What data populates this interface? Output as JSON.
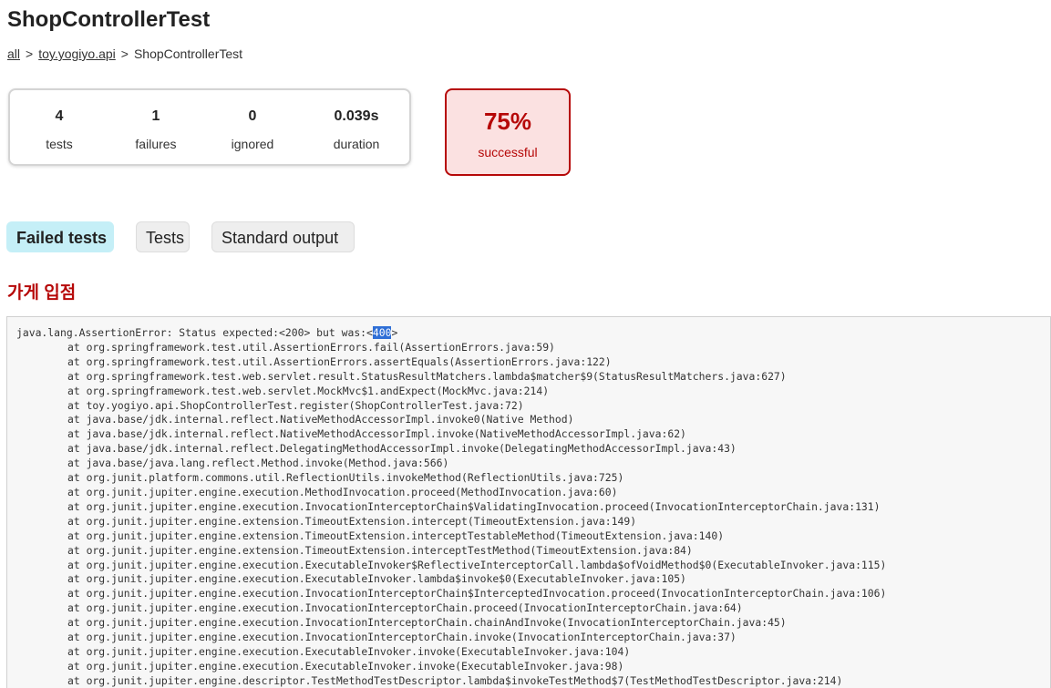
{
  "header": {
    "title": "ShopControllerTest"
  },
  "breadcrumb": {
    "items": [
      {
        "label": "all",
        "link": true
      },
      {
        "label": "toy.yogiyo.api",
        "link": true
      },
      {
        "label": "ShopControllerTest",
        "link": false
      }
    ],
    "separator": ">"
  },
  "summary": {
    "tests": {
      "value": "4",
      "label": "tests"
    },
    "failures": {
      "value": "1",
      "label": "failures"
    },
    "ignored": {
      "value": "0",
      "label": "ignored"
    },
    "duration": {
      "value": "0.039s",
      "label": "duration"
    },
    "success_rate": {
      "value": "75%",
      "label": "successful"
    }
  },
  "tabs": [
    {
      "label": "Failed tests",
      "selected": true
    },
    {
      "label": "Tests",
      "selected": false
    },
    {
      "label": "Standard output",
      "selected": false
    }
  ],
  "failed_test": {
    "name": "가게 입점",
    "first_line_prefix": "java.lang.AssertionError: Status expected:<200> but was:<",
    "first_line_highlight": "400",
    "first_line_suffix": ">",
    "frames": [
      "at org.springframework.test.util.AssertionErrors.fail(AssertionErrors.java:59)",
      "at org.springframework.test.util.AssertionErrors.assertEquals(AssertionErrors.java:122)",
      "at org.springframework.test.web.servlet.result.StatusResultMatchers.lambda$matcher$9(StatusResultMatchers.java:627)",
      "at org.springframework.test.web.servlet.MockMvc$1.andExpect(MockMvc.java:214)",
      "at toy.yogiyo.api.ShopControllerTest.register(ShopControllerTest.java:72)",
      "at java.base/jdk.internal.reflect.NativeMethodAccessorImpl.invoke0(Native Method)",
      "at java.base/jdk.internal.reflect.NativeMethodAccessorImpl.invoke(NativeMethodAccessorImpl.java:62)",
      "at java.base/jdk.internal.reflect.DelegatingMethodAccessorImpl.invoke(DelegatingMethodAccessorImpl.java:43)",
      "at java.base/java.lang.reflect.Method.invoke(Method.java:566)",
      "at org.junit.platform.commons.util.ReflectionUtils.invokeMethod(ReflectionUtils.java:725)",
      "at org.junit.jupiter.engine.execution.MethodInvocation.proceed(MethodInvocation.java:60)",
      "at org.junit.jupiter.engine.execution.InvocationInterceptorChain$ValidatingInvocation.proceed(InvocationInterceptorChain.java:131)",
      "at org.junit.jupiter.engine.extension.TimeoutExtension.intercept(TimeoutExtension.java:149)",
      "at org.junit.jupiter.engine.extension.TimeoutExtension.interceptTestableMethod(TimeoutExtension.java:140)",
      "at org.junit.jupiter.engine.extension.TimeoutExtension.interceptTestMethod(TimeoutExtension.java:84)",
      "at org.junit.jupiter.engine.execution.ExecutableInvoker$ReflectiveInterceptorCall.lambda$ofVoidMethod$0(ExecutableInvoker.java:115)",
      "at org.junit.jupiter.engine.execution.ExecutableInvoker.lambda$invoke$0(ExecutableInvoker.java:105)",
      "at org.junit.jupiter.engine.execution.InvocationInterceptorChain$InterceptedInvocation.proceed(InvocationInterceptorChain.java:106)",
      "at org.junit.jupiter.engine.execution.InvocationInterceptorChain.proceed(InvocationInterceptorChain.java:64)",
      "at org.junit.jupiter.engine.execution.InvocationInterceptorChain.chainAndInvoke(InvocationInterceptorChain.java:45)",
      "at org.junit.jupiter.engine.execution.InvocationInterceptorChain.invoke(InvocationInterceptorChain.java:37)",
      "at org.junit.jupiter.engine.execution.ExecutableInvoker.invoke(ExecutableInvoker.java:104)",
      "at org.junit.jupiter.engine.execution.ExecutableInvoker.invoke(ExecutableInvoker.java:98)",
      "at org.junit.jupiter.engine.descriptor.TestMethodTestDescriptor.lambda$invokeTestMethod$7(TestMethodTestDescriptor.java:214)"
    ]
  },
  "colors": {
    "failure_red": "#b60808",
    "failure_bg": "#fbe1e1",
    "selected_tab_bg": "#c5eff7",
    "selection_highlight": "#2f6fd6"
  }
}
